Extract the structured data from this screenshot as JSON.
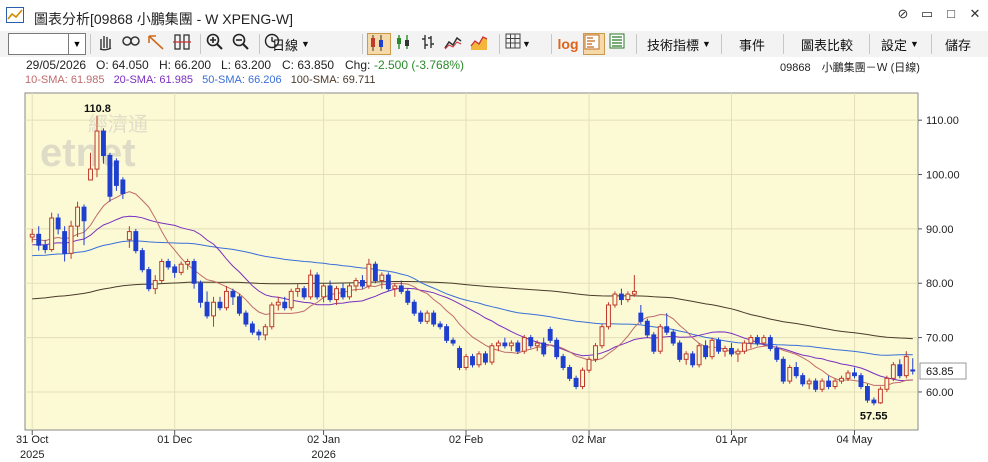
{
  "window": {
    "title": "圖表分析[09868 小鵬集團 - W XPENG-W]",
    "buttons": [
      "attach-icon",
      "minimize-icon",
      "maximize-icon",
      "close-icon"
    ]
  },
  "toolbar": {
    "symbol_input": "",
    "period_label": "日線",
    "log_label": "log",
    "indicators_label": "技術指標",
    "events_label": "事件",
    "compare_label": "圖表比較",
    "settings_label": "設定",
    "save_label": "儲存"
  },
  "quote": {
    "date": "29/05/2026",
    "open": "O: 64.050",
    "high": "H: 66.200",
    "low": "L: 63.200",
    "close": "C: 63.850",
    "change_label": "Chg:",
    "change": "-2.500 (-3.768%)",
    "right_label": "09868　小鵬集團－Ｗ (日線)"
  },
  "sma": {
    "sma10": "10-SMA: 61.985",
    "sma20": "20-SMA: 61.985",
    "sma50": "50-SMA: 66.206",
    "sma100": "100-SMA: 69.711"
  },
  "colors": {
    "up_candle": "#c0392b",
    "down_candle": "#1f3fcf",
    "sma10": "#c06b6b",
    "sma20": "#7b2fbf",
    "sma50": "#3a6fd8",
    "sma100": "#4a3a2a",
    "plot_bg": "#fbfad5"
  },
  "watermark": {
    "top": "經濟通",
    "bottom": "etnet"
  },
  "chart_data": {
    "type": "candlestick",
    "y_axis": {
      "min": 53,
      "max": 115,
      "ticks": [
        60.0,
        70.0,
        80.0,
        90.0,
        100.0,
        110.0
      ],
      "tick_labels": [
        "60.00",
        "70.00",
        "80.00",
        "90.00",
        "100.00",
        "110.00"
      ]
    },
    "last_price_label": "63.85",
    "high_annotation": "110.8",
    "low_annotation": "57.55",
    "x_labels": [
      {
        "index": 0,
        "label": "31 Oct",
        "sub": "2025"
      },
      {
        "index": 22,
        "label": "01 Dec",
        "sub": ""
      },
      {
        "index": 45,
        "label": "02 Jan",
        "sub": "2026"
      },
      {
        "index": 67,
        "label": "02 Feb",
        "sub": ""
      },
      {
        "index": 86,
        "label": "02 Mar",
        "sub": ""
      },
      {
        "index": 108,
        "label": "01 Apr",
        "sub": ""
      },
      {
        "index": 127,
        "label": "04 May",
        "sub": ""
      }
    ],
    "candles": [
      [
        88.5,
        90.0,
        87.5,
        89.0
      ],
      [
        89.0,
        90.5,
        86.0,
        87.0
      ],
      [
        87.0,
        88.0,
        85.5,
        86.2
      ],
      [
        86.2,
        93.0,
        85.8,
        92.0
      ],
      [
        92.0,
        92.8,
        89.0,
        90.0
      ],
      [
        89.5,
        90.5,
        84.0,
        85.5
      ],
      [
        85.5,
        91.5,
        84.5,
        90.5
      ],
      [
        90.5,
        95.0,
        88.5,
        94.0
      ],
      [
        94.0,
        94.5,
        87.0,
        91.5
      ],
      [
        99.0,
        104.0,
        100.0,
        101.0
      ],
      [
        101.0,
        110.8,
        99.5,
        108.0
      ],
      [
        108.0,
        108.5,
        102.0,
        103.5
      ],
      [
        103.5,
        104.0,
        95.0,
        96.0
      ],
      [
        102.5,
        103.0,
        97.0,
        98.0
      ],
      [
        99.0,
        99.5,
        95.5,
        96.5
      ],
      [
        88.0,
        90.5,
        86.5,
        89.5
      ],
      [
        89.5,
        90.0,
        85.5,
        86.0
      ],
      [
        86.0,
        86.5,
        82.0,
        82.5
      ],
      [
        82.5,
        83.0,
        78.5,
        79.0
      ],
      [
        79.0,
        81.5,
        78.0,
        80.5
      ],
      [
        80.5,
        84.5,
        80.0,
        84.0
      ],
      [
        84.0,
        84.5,
        82.5,
        83.0
      ],
      [
        83.0,
        83.5,
        81.0,
        82.0
      ],
      [
        82.0,
        84.0,
        81.5,
        83.5
      ],
      [
        83.5,
        84.5,
        82.5,
        84.0
      ],
      [
        84.0,
        84.5,
        79.0,
        80.0
      ],
      [
        80.0,
        80.5,
        75.5,
        76.5
      ],
      [
        76.5,
        78.5,
        73.5,
        74.0
      ],
      [
        74.0,
        77.5,
        72.0,
        76.5
      ],
      [
        76.5,
        77.5,
        75.0,
        75.5
      ],
      [
        75.5,
        79.5,
        75.0,
        78.5
      ],
      [
        78.5,
        79.0,
        76.0,
        77.5
      ],
      [
        77.5,
        78.0,
        74.0,
        74.5
      ],
      [
        74.5,
        75.0,
        72.0,
        72.5
      ],
      [
        72.5,
        73.0,
        70.5,
        71.0
      ],
      [
        71.0,
        71.5,
        69.5,
        70.5
      ],
      [
        70.5,
        72.5,
        69.5,
        72.0
      ],
      [
        72.0,
        76.5,
        71.5,
        76.0
      ],
      [
        76.0,
        77.5,
        75.0,
        76.5
      ],
      [
        76.5,
        77.5,
        75.0,
        75.5
      ],
      [
        75.5,
        79.0,
        75.0,
        78.5
      ],
      [
        78.5,
        80.0,
        77.5,
        79.0
      ],
      [
        79.0,
        79.5,
        77.0,
        77.5
      ],
      [
        77.5,
        82.5,
        77.0,
        81.5
      ],
      [
        81.5,
        82.0,
        77.0,
        77.5
      ],
      [
        77.5,
        80.0,
        76.5,
        79.5
      ],
      [
        79.5,
        80.5,
        76.5,
        77.0
      ],
      [
        77.0,
        79.5,
        76.0,
        79.0
      ],
      [
        79.0,
        80.0,
        77.0,
        77.5
      ],
      [
        77.5,
        80.0,
        77.0,
        79.5
      ],
      [
        79.5,
        81.0,
        78.5,
        80.5
      ],
      [
        80.5,
        81.5,
        79.0,
        79.5
      ],
      [
        79.5,
        84.5,
        79.0,
        83.5
      ],
      [
        83.5,
        84.0,
        80.0,
        80.5
      ],
      [
        80.5,
        82.0,
        79.0,
        81.5
      ],
      [
        81.5,
        82.0,
        78.5,
        79.0
      ],
      [
        79.0,
        80.0,
        77.5,
        79.5
      ],
      [
        79.5,
        80.5,
        78.0,
        78.5
      ],
      [
        78.5,
        79.0,
        76.0,
        76.5
      ],
      [
        76.5,
        77.0,
        74.0,
        74.5
      ],
      [
        74.5,
        75.0,
        72.5,
        73.0
      ],
      [
        73.0,
        75.0,
        72.5,
        74.5
      ],
      [
        74.5,
        75.0,
        72.0,
        72.5
      ],
      [
        72.5,
        73.0,
        71.5,
        72.0
      ],
      [
        72.0,
        72.5,
        69.0,
        69.5
      ],
      [
        69.5,
        70.0,
        68.5,
        69.0
      ],
      [
        68.0,
        68.5,
        64.0,
        64.5
      ],
      [
        64.5,
        67.0,
        64.0,
        66.5
      ],
      [
        66.5,
        67.0,
        64.5,
        65.0
      ],
      [
        65.0,
        67.5,
        64.5,
        67.0
      ],
      [
        67.0,
        67.5,
        65.0,
        65.5
      ],
      [
        65.5,
        69.0,
        65.0,
        68.5
      ],
      [
        68.5,
        69.5,
        67.5,
        69.0
      ],
      [
        69.0,
        70.0,
        68.0,
        68.5
      ],
      [
        68.5,
        69.5,
        67.5,
        69.0
      ],
      [
        69.0,
        69.5,
        67.0,
        67.5
      ],
      [
        67.5,
        70.5,
        67.0,
        70.0
      ],
      [
        70.0,
        70.5,
        68.0,
        68.5
      ],
      [
        68.5,
        69.5,
        67.5,
        69.0
      ],
      [
        69.0,
        70.0,
        66.5,
        67.0
      ],
      [
        71.5,
        72.0,
        69.0,
        69.5
      ],
      [
        69.5,
        70.0,
        66.0,
        66.5
      ],
      [
        66.5,
        67.0,
        64.0,
        64.5
      ],
      [
        64.5,
        65.0,
        62.0,
        62.5
      ],
      [
        62.5,
        63.0,
        60.5,
        61.0
      ],
      [
        61.0,
        64.5,
        60.5,
        64.0
      ],
      [
        64.0,
        66.5,
        63.5,
        66.0
      ],
      [
        66.0,
        69.0,
        65.5,
        68.5
      ],
      [
        68.5,
        72.5,
        68.0,
        72.0
      ],
      [
        72.0,
        76.5,
        71.5,
        76.0
      ],
      [
        76.0,
        78.5,
        75.5,
        78.0
      ],
      [
        78.0,
        79.0,
        76.0,
        77.0
      ],
      [
        77.0,
        78.5,
        76.5,
        78.0
      ],
      [
        78.0,
        81.5,
        77.5,
        78.5
      ],
      [
        74.5,
        76.0,
        72.5,
        73.0
      ],
      [
        73.0,
        73.5,
        70.0,
        70.5
      ],
      [
        70.5,
        71.0,
        67.0,
        67.5
      ],
      [
        67.5,
        72.5,
        67.0,
        72.0
      ],
      [
        72.0,
        74.5,
        70.5,
        71.0
      ],
      [
        71.0,
        71.5,
        68.5,
        69.0
      ],
      [
        69.0,
        69.5,
        65.5,
        66.0
      ],
      [
        66.0,
        67.5,
        65.0,
        67.0
      ],
      [
        67.0,
        67.5,
        64.5,
        65.0
      ],
      [
        65.0,
        69.0,
        64.5,
        68.5
      ],
      [
        68.5,
        69.5,
        66.0,
        66.5
      ],
      [
        66.5,
        70.0,
        66.0,
        69.5
      ],
      [
        69.5,
        70.0,
        67.0,
        67.5
      ],
      [
        67.5,
        68.5,
        66.5,
        68.0
      ],
      [
        68.0,
        69.0,
        66.5,
        67.0
      ],
      [
        67.0,
        68.0,
        65.5,
        67.5
      ],
      [
        67.5,
        69.5,
        67.0,
        69.0
      ],
      [
        69.0,
        70.5,
        68.0,
        70.0
      ],
      [
        70.0,
        70.5,
        68.5,
        69.0
      ],
      [
        69.0,
        70.5,
        68.5,
        70.0
      ],
      [
        70.0,
        70.5,
        67.5,
        68.0
      ],
      [
        68.0,
        68.5,
        65.5,
        66.0
      ],
      [
        66.0,
        66.5,
        61.5,
        62.0
      ],
      [
        62.0,
        65.0,
        61.5,
        64.5
      ],
      [
        64.5,
        65.5,
        62.5,
        63.0
      ],
      [
        63.0,
        63.5,
        61.0,
        61.5
      ],
      [
        61.5,
        62.5,
        60.5,
        62.0
      ],
      [
        62.0,
        62.5,
        60.0,
        60.5
      ],
      [
        60.5,
        62.5,
        60.0,
        62.0
      ],
      [
        62.0,
        63.0,
        60.5,
        61.0
      ],
      [
        61.0,
        62.5,
        60.5,
        62.0
      ],
      [
        62.0,
        63.0,
        61.5,
        62.5
      ],
      [
        62.5,
        64.0,
        62.0,
        63.5
      ],
      [
        63.5,
        64.5,
        62.5,
        63.0
      ],
      [
        63.0,
        63.5,
        60.5,
        61.0
      ],
      [
        61.0,
        61.5,
        58.0,
        58.5
      ],
      [
        58.5,
        59.0,
        57.55,
        58.0
      ],
      [
        58.0,
        61.0,
        57.8,
        60.5
      ],
      [
        60.5,
        63.0,
        60.0,
        62.5
      ],
      [
        62.5,
        65.5,
        62.0,
        65.0
      ],
      [
        65.0,
        66.0,
        62.5,
        63.0
      ],
      [
        63.0,
        67.5,
        62.5,
        66.5
      ],
      [
        64.05,
        66.2,
        63.2,
        63.85
      ]
    ]
  }
}
